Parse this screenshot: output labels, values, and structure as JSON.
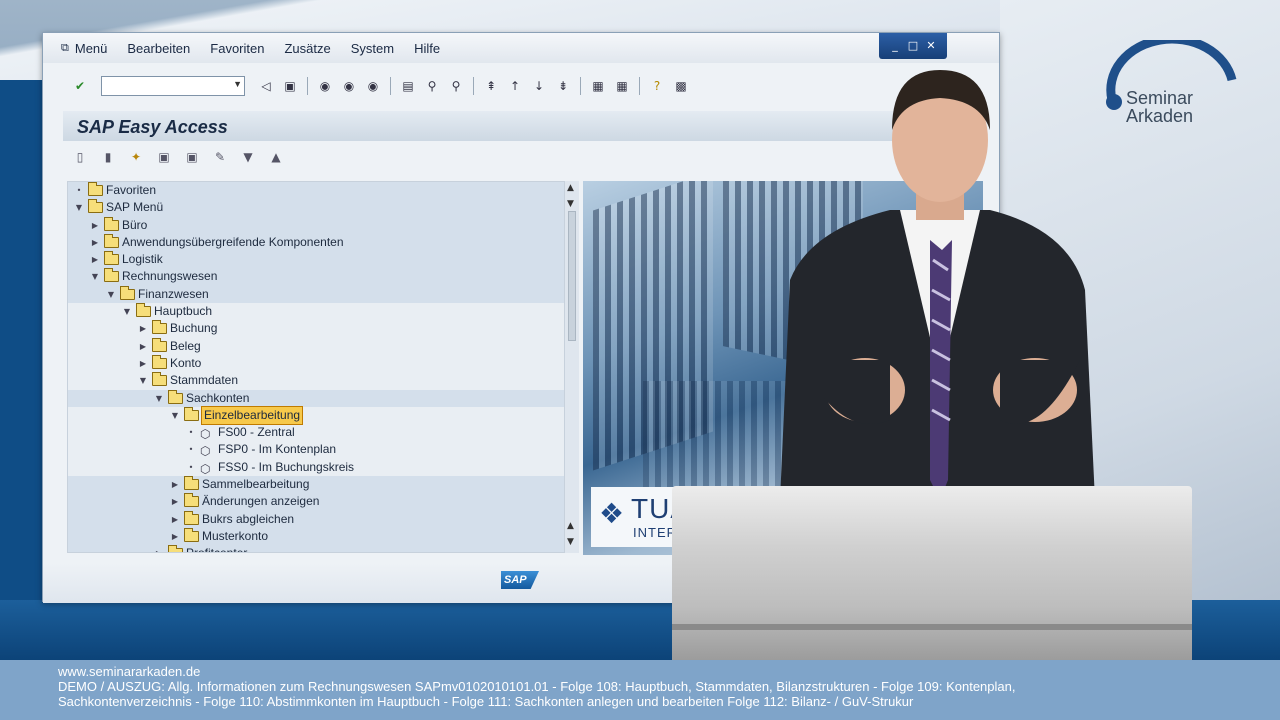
{
  "menubar": {
    "items": [
      "Menü",
      "Bearbeiten",
      "Favoriten",
      "Zusätze",
      "System",
      "Hilfe"
    ]
  },
  "window_controls": [
    "_",
    "□",
    "✕"
  ],
  "title": "SAP Easy Access",
  "tree": [
    {
      "level": 0,
      "label": "Favoriten",
      "arrow": "•",
      "hl": true
    },
    {
      "level": 0,
      "label": "SAP Menü",
      "arrow": "▼",
      "hl": true
    },
    {
      "level": 1,
      "label": "Büro",
      "arrow": "▶",
      "hl": true
    },
    {
      "level": 1,
      "label": "Anwendungsübergreifende Komponenten",
      "arrow": "▶",
      "hl": true
    },
    {
      "level": 1,
      "label": "Logistik",
      "arrow": "▶",
      "hl": true
    },
    {
      "level": 1,
      "label": "Rechnungswesen",
      "arrow": "▼",
      "hl": true
    },
    {
      "level": 2,
      "label": "Finanzwesen",
      "arrow": "▼",
      "hl": true
    },
    {
      "level": 3,
      "label": "Hauptbuch",
      "arrow": "▼",
      "hl": false
    },
    {
      "level": 4,
      "label": "Buchung",
      "arrow": "▶",
      "hl": false
    },
    {
      "level": 4,
      "label": "Beleg",
      "arrow": "▶",
      "hl": false
    },
    {
      "level": 4,
      "label": "Konto",
      "arrow": "▶",
      "hl": false
    },
    {
      "level": 4,
      "label": "Stammdaten",
      "arrow": "▼",
      "hl": false
    },
    {
      "level": 5,
      "label": "Sachkonten",
      "arrow": "▼",
      "hl": true
    },
    {
      "level": 6,
      "label": "Einzelbearbeitung",
      "arrow": "▼",
      "hl": false,
      "selected": true
    },
    {
      "level": 7,
      "label": "FS00 - Zentral",
      "arrow": "•",
      "hl": false,
      "tx": true
    },
    {
      "level": 7,
      "label": "FSP0 - Im Kontenplan",
      "arrow": "•",
      "hl": false,
      "tx": true
    },
    {
      "level": 7,
      "label": "FSS0 - Im Buchungskreis",
      "arrow": "•",
      "hl": false,
      "tx": true
    },
    {
      "level": 6,
      "label": "Sammelbearbeitung",
      "arrow": "▶",
      "hl": true
    },
    {
      "level": 6,
      "label": "Änderungen anzeigen",
      "arrow": "▶",
      "hl": true
    },
    {
      "level": 6,
      "label": "Bukrs abgleichen",
      "arrow": "▶",
      "hl": true
    },
    {
      "level": 6,
      "label": "Musterkonto",
      "arrow": "▶",
      "hl": true
    },
    {
      "level": 5,
      "label": "Profitcenter",
      "arrow": "▶",
      "hl": true
    }
  ],
  "image_logo": {
    "line1": "TUA",
    "line2": "INTERN"
  },
  "sap_logo": "SAP",
  "brand": {
    "line1": "Seminar",
    "line2": "Arkaden"
  },
  "footer": {
    "url": "www.seminararkaden.de",
    "line1": "DEMO / AUSZUG: Allg. Informationen zum Rechnungswesen SAPmv0102010101.01 - Folge 108: Hauptbuch, Stammdaten, Bilanzstrukturen - Folge 109: Kontenplan,",
    "line2": "Sachkontenverzeichnis - Folge 110: Abstimmkonten im Hauptbuch - Folge 111: Sachkonten anlegen und bearbeiten Folge 112: Bilanz- / GuV-Strukur"
  }
}
